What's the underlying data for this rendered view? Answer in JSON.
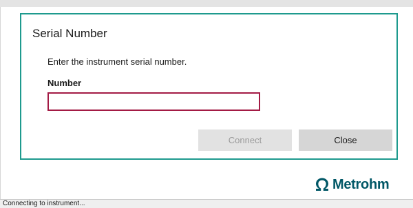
{
  "dialog": {
    "title": "Serial Number",
    "description": "Enter the instrument serial number.",
    "field_label": "Number",
    "field_value": "",
    "field_placeholder": "",
    "connect_label": "Connect",
    "close_label": "Close"
  },
  "brand": {
    "name": "Metrohm",
    "icon": "omega-logo-icon",
    "color": "#005766"
  },
  "status_bar": {
    "text": "Connecting to instrument..."
  },
  "colors": {
    "dialog_border": "#1e9a8e",
    "input_border": "#a31a44"
  }
}
